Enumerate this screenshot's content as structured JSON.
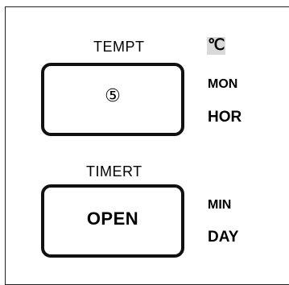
{
  "panel": {
    "tempt": {
      "label": "TEMPT",
      "button_value": "⑤",
      "units": {
        "celsius": "℃",
        "mon": "MON",
        "hor": "HOR"
      }
    },
    "timert": {
      "label": "TIMERT",
      "button_value": "OPEN",
      "units": {
        "min": "MIN",
        "day": "DAY"
      }
    }
  }
}
